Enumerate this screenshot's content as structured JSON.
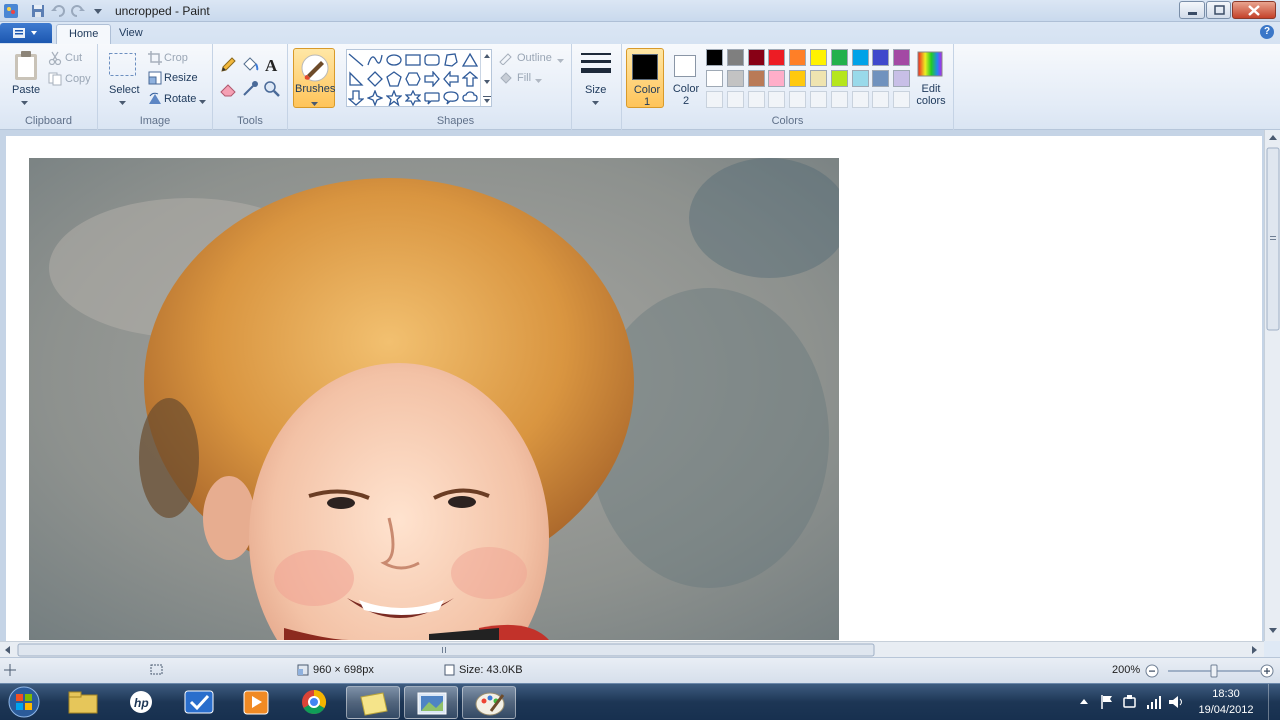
{
  "window": {
    "title": "uncropped - Paint"
  },
  "tabs": [
    {
      "label": "Home"
    },
    {
      "label": "View"
    }
  ],
  "clipboard": {
    "paste": "Paste",
    "cut": "Cut",
    "copy": "Copy",
    "group": "Clipboard"
  },
  "image": {
    "select": "Select",
    "crop": "Crop",
    "resize": "Resize",
    "rotate": "Rotate",
    "group": "Image"
  },
  "tools": {
    "group": "Tools"
  },
  "brushes": {
    "label": "Brushes"
  },
  "shapes": {
    "outline": "Outline",
    "fill": "Fill",
    "group": "Shapes"
  },
  "size": {
    "label": "Size"
  },
  "colors": {
    "color1": "Color 1",
    "color2": "Color 2",
    "edit": "Edit colors",
    "group": "Colors",
    "color1_value": "#000000",
    "color2_value": "#ffffff",
    "palette_row1": [
      "#000000",
      "#7f7f7f",
      "#880015",
      "#ed1c24",
      "#ff7f27",
      "#fff200",
      "#22b14c",
      "#00a2e8",
      "#3f48cc",
      "#a349a4"
    ],
    "palette_row2": [
      "#ffffff",
      "#c3c3c3",
      "#b97a57",
      "#ffaec9",
      "#ffc90e",
      "#efe4b0",
      "#b5e61d",
      "#99d9ea",
      "#7092be",
      "#c8bfe7"
    ]
  },
  "status": {
    "dimensions": "960 × 698px",
    "size": "Size: 43.0KB",
    "zoom": "200%"
  },
  "taskbar": {
    "time": "18:30",
    "date": "19/04/2012"
  }
}
